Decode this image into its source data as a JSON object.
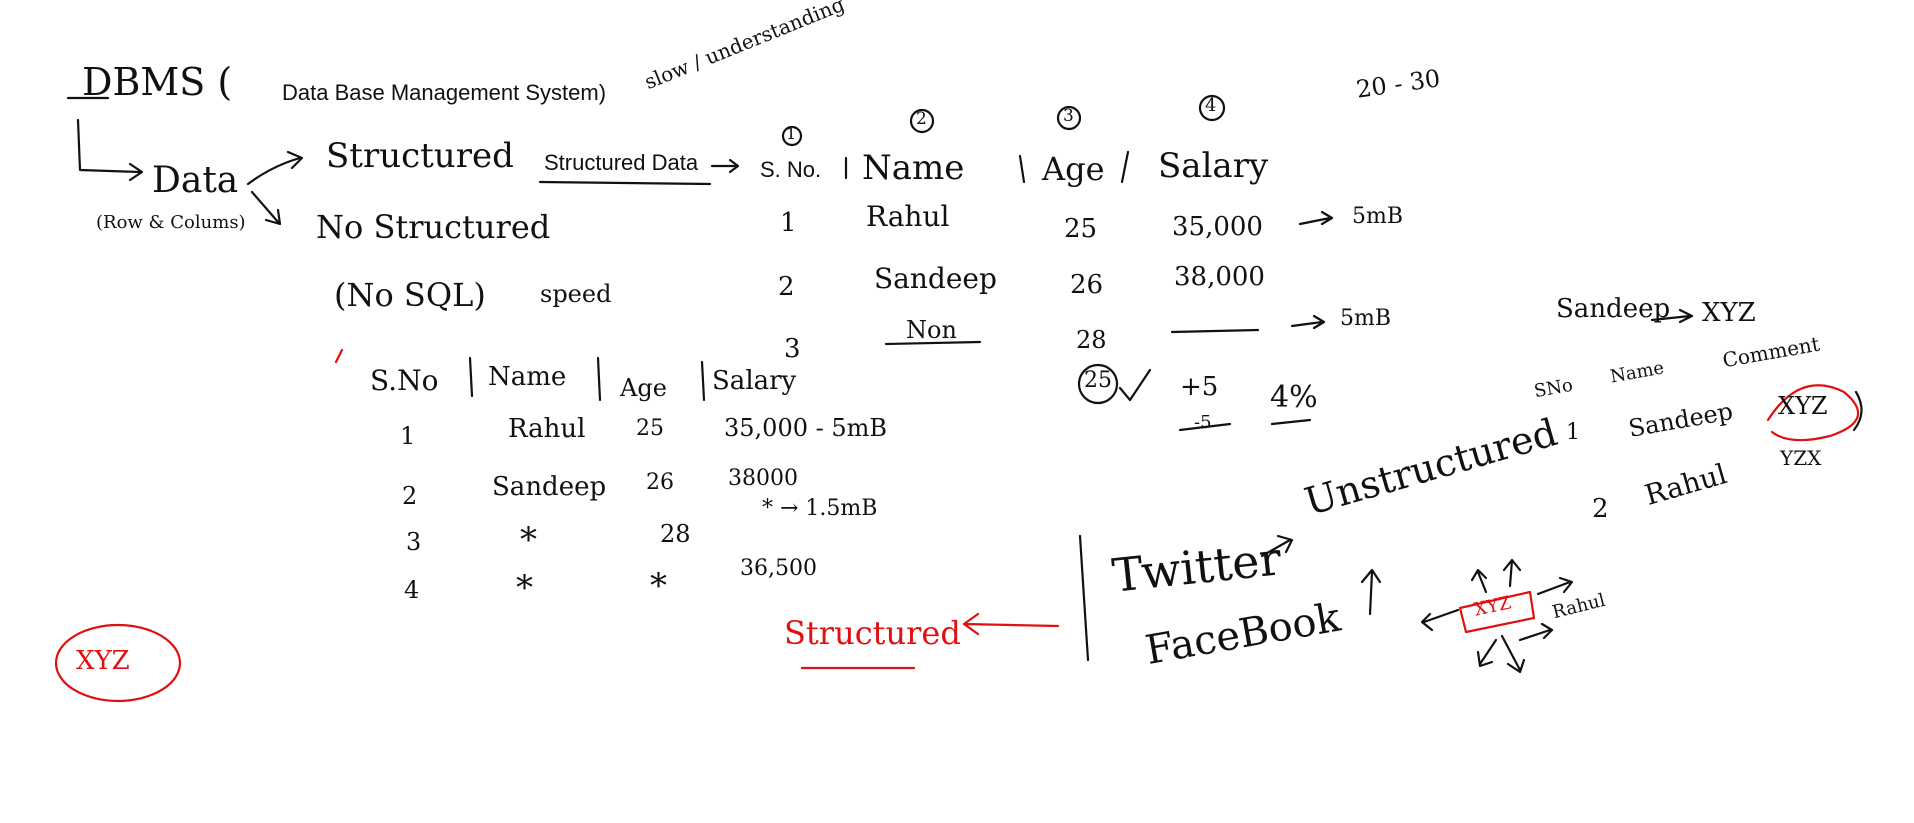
{
  "top": {
    "dbms": "DBMS (",
    "typed_title": "Data Base Management System)",
    "range": "20 - 30",
    "slow": "slow / understanding",
    "data": "Data",
    "row_col": "(Row & Colums)",
    "structured": "Structured",
    "no_structured": "No Structured",
    "nosql": "(No SQL)",
    "speed": "speed",
    "typed_structured": "Structured Data",
    "typed_sno": "S. No."
  },
  "table1": {
    "nums": [
      "1",
      "2",
      "3",
      "4"
    ],
    "headers": [
      "Name",
      "Age",
      "Salary"
    ],
    "rows": [
      {
        "sn": "1",
        "name": "Rahul",
        "age": "25",
        "salary": "35,000",
        "note": "5mB"
      },
      {
        "sn": "2",
        "name": "Sandeep",
        "age": "26",
        "salary": "38,000",
        "note": ""
      },
      {
        "sn": "3",
        "name": "Non",
        "age": "28",
        "salary": "",
        "note": "5mB"
      }
    ]
  },
  "middle": {
    "circled": "25",
    "plus": "+5",
    "minus": "-5",
    "pct": "4%"
  },
  "table2": {
    "headers": [
      "S.No",
      "Name",
      "Age",
      "Salary"
    ],
    "rows": [
      {
        "sn": "1",
        "name": "Rahul",
        "age": "25",
        "salary": "35,000 - 5mB"
      },
      {
        "sn": "2",
        "name": "Sandeep",
        "age": "26",
        "salary": "38000"
      },
      {
        "sn": "3",
        "name": "*",
        "age": "28",
        "salary": "* → 1.5mB"
      },
      {
        "sn": "4",
        "name": "*",
        "age": "*",
        "salary": "36,500"
      }
    ]
  },
  "left_circle": "XYZ",
  "bottom": {
    "structured_red": "Structured",
    "twitter": "Twitter",
    "unstructured": "Unstructured",
    "facebook": "FaceBook",
    "xyz_box": "XYZ",
    "rahul": "Rahul"
  },
  "right": {
    "sandeep": "Sandeep",
    "xyz": "XYZ",
    "headers": [
      "SNo",
      "Name",
      "Comment"
    ],
    "row1_sn": "1",
    "row1_name": "Sandeep",
    "row1_comment": "XYZ",
    "row1_sub": "YZX",
    "row2_sn": "2",
    "row2_name": "Rahul"
  }
}
